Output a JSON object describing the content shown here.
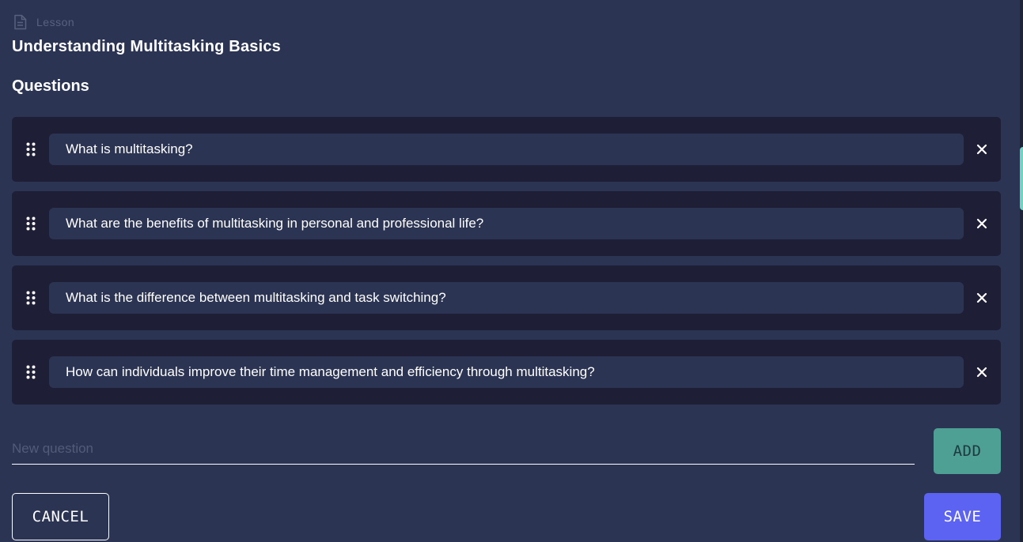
{
  "breadcrumb": {
    "icon": "document-icon",
    "label": "Lesson"
  },
  "lesson": {
    "title": "Understanding Multitasking Basics"
  },
  "questions_section": {
    "heading": "Questions",
    "items": [
      {
        "text": "What is multitasking?"
      },
      {
        "text": "What are the benefits of multitasking in personal and professional life?"
      },
      {
        "text": "What is the difference between multitasking and task switching?"
      },
      {
        "text": "How can individuals improve their time management and efficiency through multitasking?"
      }
    ],
    "drag_icon": "drag-handle-icon",
    "remove_icon": "close-icon"
  },
  "new_question": {
    "placeholder": "New question",
    "value": "",
    "add_label": "ADD"
  },
  "actions": {
    "cancel_label": "CANCEL",
    "save_label": "SAVE"
  },
  "colors": {
    "background": "#2b3553",
    "card": "#1e1e36",
    "add_button": "#4e9f94",
    "save_button": "#5c63f2",
    "accent": "#6fd3c0"
  }
}
